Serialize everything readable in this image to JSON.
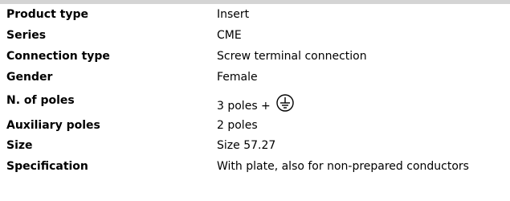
{
  "specs": {
    "rows": [
      {
        "label": "Product type",
        "value": "Insert"
      },
      {
        "label": "Series",
        "value": "CME"
      },
      {
        "label": "Connection type",
        "value": "Screw terminal connection"
      },
      {
        "label": "Gender",
        "value": "Female"
      },
      {
        "label": "N. of poles",
        "value": "3 poles +",
        "icon": "protective-earth-ground-icon"
      },
      {
        "label": "Auxiliary poles",
        "value": "2 poles"
      },
      {
        "label": "Size",
        "value": "Size 57.27"
      },
      {
        "label": "Specification",
        "value": "With plate, also for non-prepared conductors"
      }
    ]
  },
  "colors": {
    "header_bar": "#d4d4d4",
    "text": "#000000",
    "background": "#ffffff"
  }
}
